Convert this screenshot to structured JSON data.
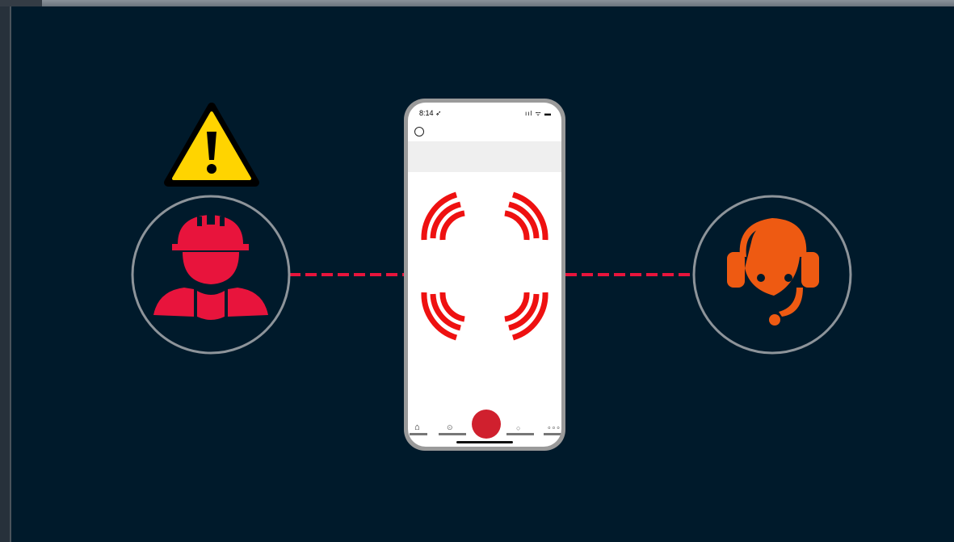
{
  "phone": {
    "status_time": "8:14 ➶",
    "status_icons": "ııl ᯤ ▬"
  },
  "icons": {
    "warning": "warning-triangle-icon",
    "worker": "construction-worker-icon",
    "operator": "headset-operator-icon",
    "signal": "radio-signal-icon"
  },
  "colors": {
    "background": "#001a2b",
    "alert_red": "#e8143c",
    "operator_orange": "#ee5a12",
    "warning_yellow": "#ffd400",
    "ring_gray": "#8d949a"
  }
}
